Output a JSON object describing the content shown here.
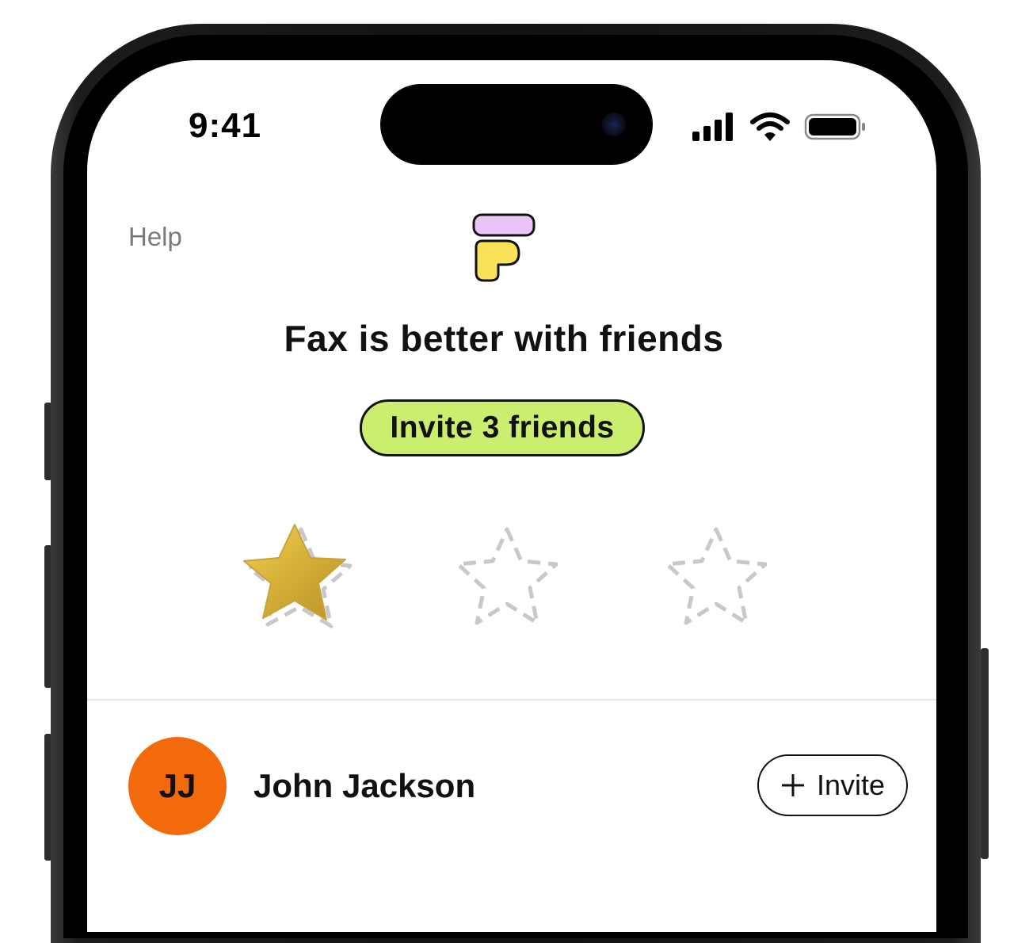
{
  "status_bar": {
    "time": "9:41",
    "icons": [
      "cellular-signal-icon",
      "wifi-icon",
      "battery-icon"
    ]
  },
  "header": {
    "help_label": "Help",
    "logo_icon": "fax-logo-icon"
  },
  "headline": "Fax is better with friends",
  "invite_goal": {
    "label": "Invite 3 friends",
    "color": "#ccee6e",
    "earned_stars": 1,
    "total_stars": 3
  },
  "contacts": [
    {
      "initials": "JJ",
      "name": "John Jackson",
      "avatar_color": "#f26a0c",
      "action_label": "Invite"
    }
  ],
  "colors": {
    "logo_purple": "#e9c4f6",
    "logo_yellow": "#f8e25a",
    "star_gold": "#d9b73c",
    "star_outline": "#c8c8c8"
  }
}
